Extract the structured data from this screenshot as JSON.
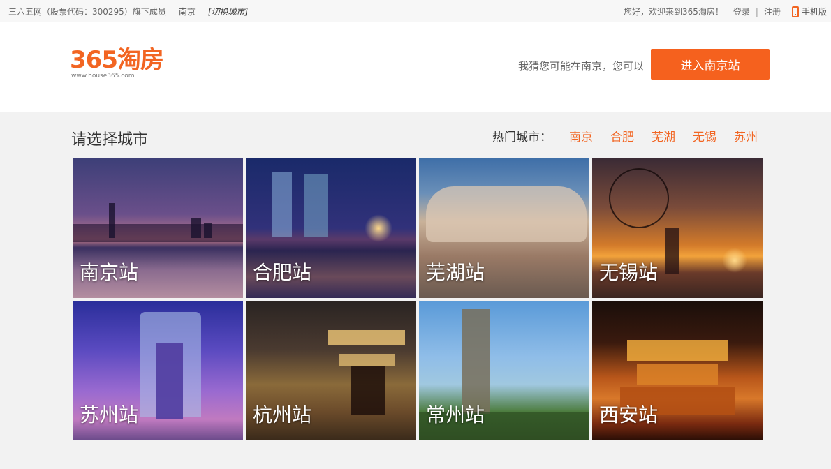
{
  "topbar": {
    "left_text": "三六五网（股票代码：300295）旗下成员",
    "city": "南京",
    "switch_city": "[切换城市]",
    "greeting": "您好，欢迎来到365淘房！",
    "login": "登录",
    "separator": "|",
    "register": "注册",
    "mobile": "手机版"
  },
  "header": {
    "logo_text": "365淘房",
    "logo_url": "www.house365.com",
    "guess_text": "我猜您可能在南京，您可以",
    "enter_button": "进入南京站"
  },
  "content": {
    "title": "请选择城市",
    "hot_label": "热门城市：",
    "hot_cities": [
      "南京",
      "合肥",
      "芜湖",
      "无锡",
      "苏州"
    ],
    "tiles": [
      {
        "label": "南京站"
      },
      {
        "label": "合肥站"
      },
      {
        "label": "芜湖站"
      },
      {
        "label": "无锡站"
      },
      {
        "label": "苏州站"
      },
      {
        "label": "杭州站"
      },
      {
        "label": "常州站"
      },
      {
        "label": "西安站"
      }
    ]
  },
  "colors": {
    "accent": "#f26522",
    "button": "#f5611e"
  },
  "icons": {
    "mobile": "phone-icon"
  }
}
